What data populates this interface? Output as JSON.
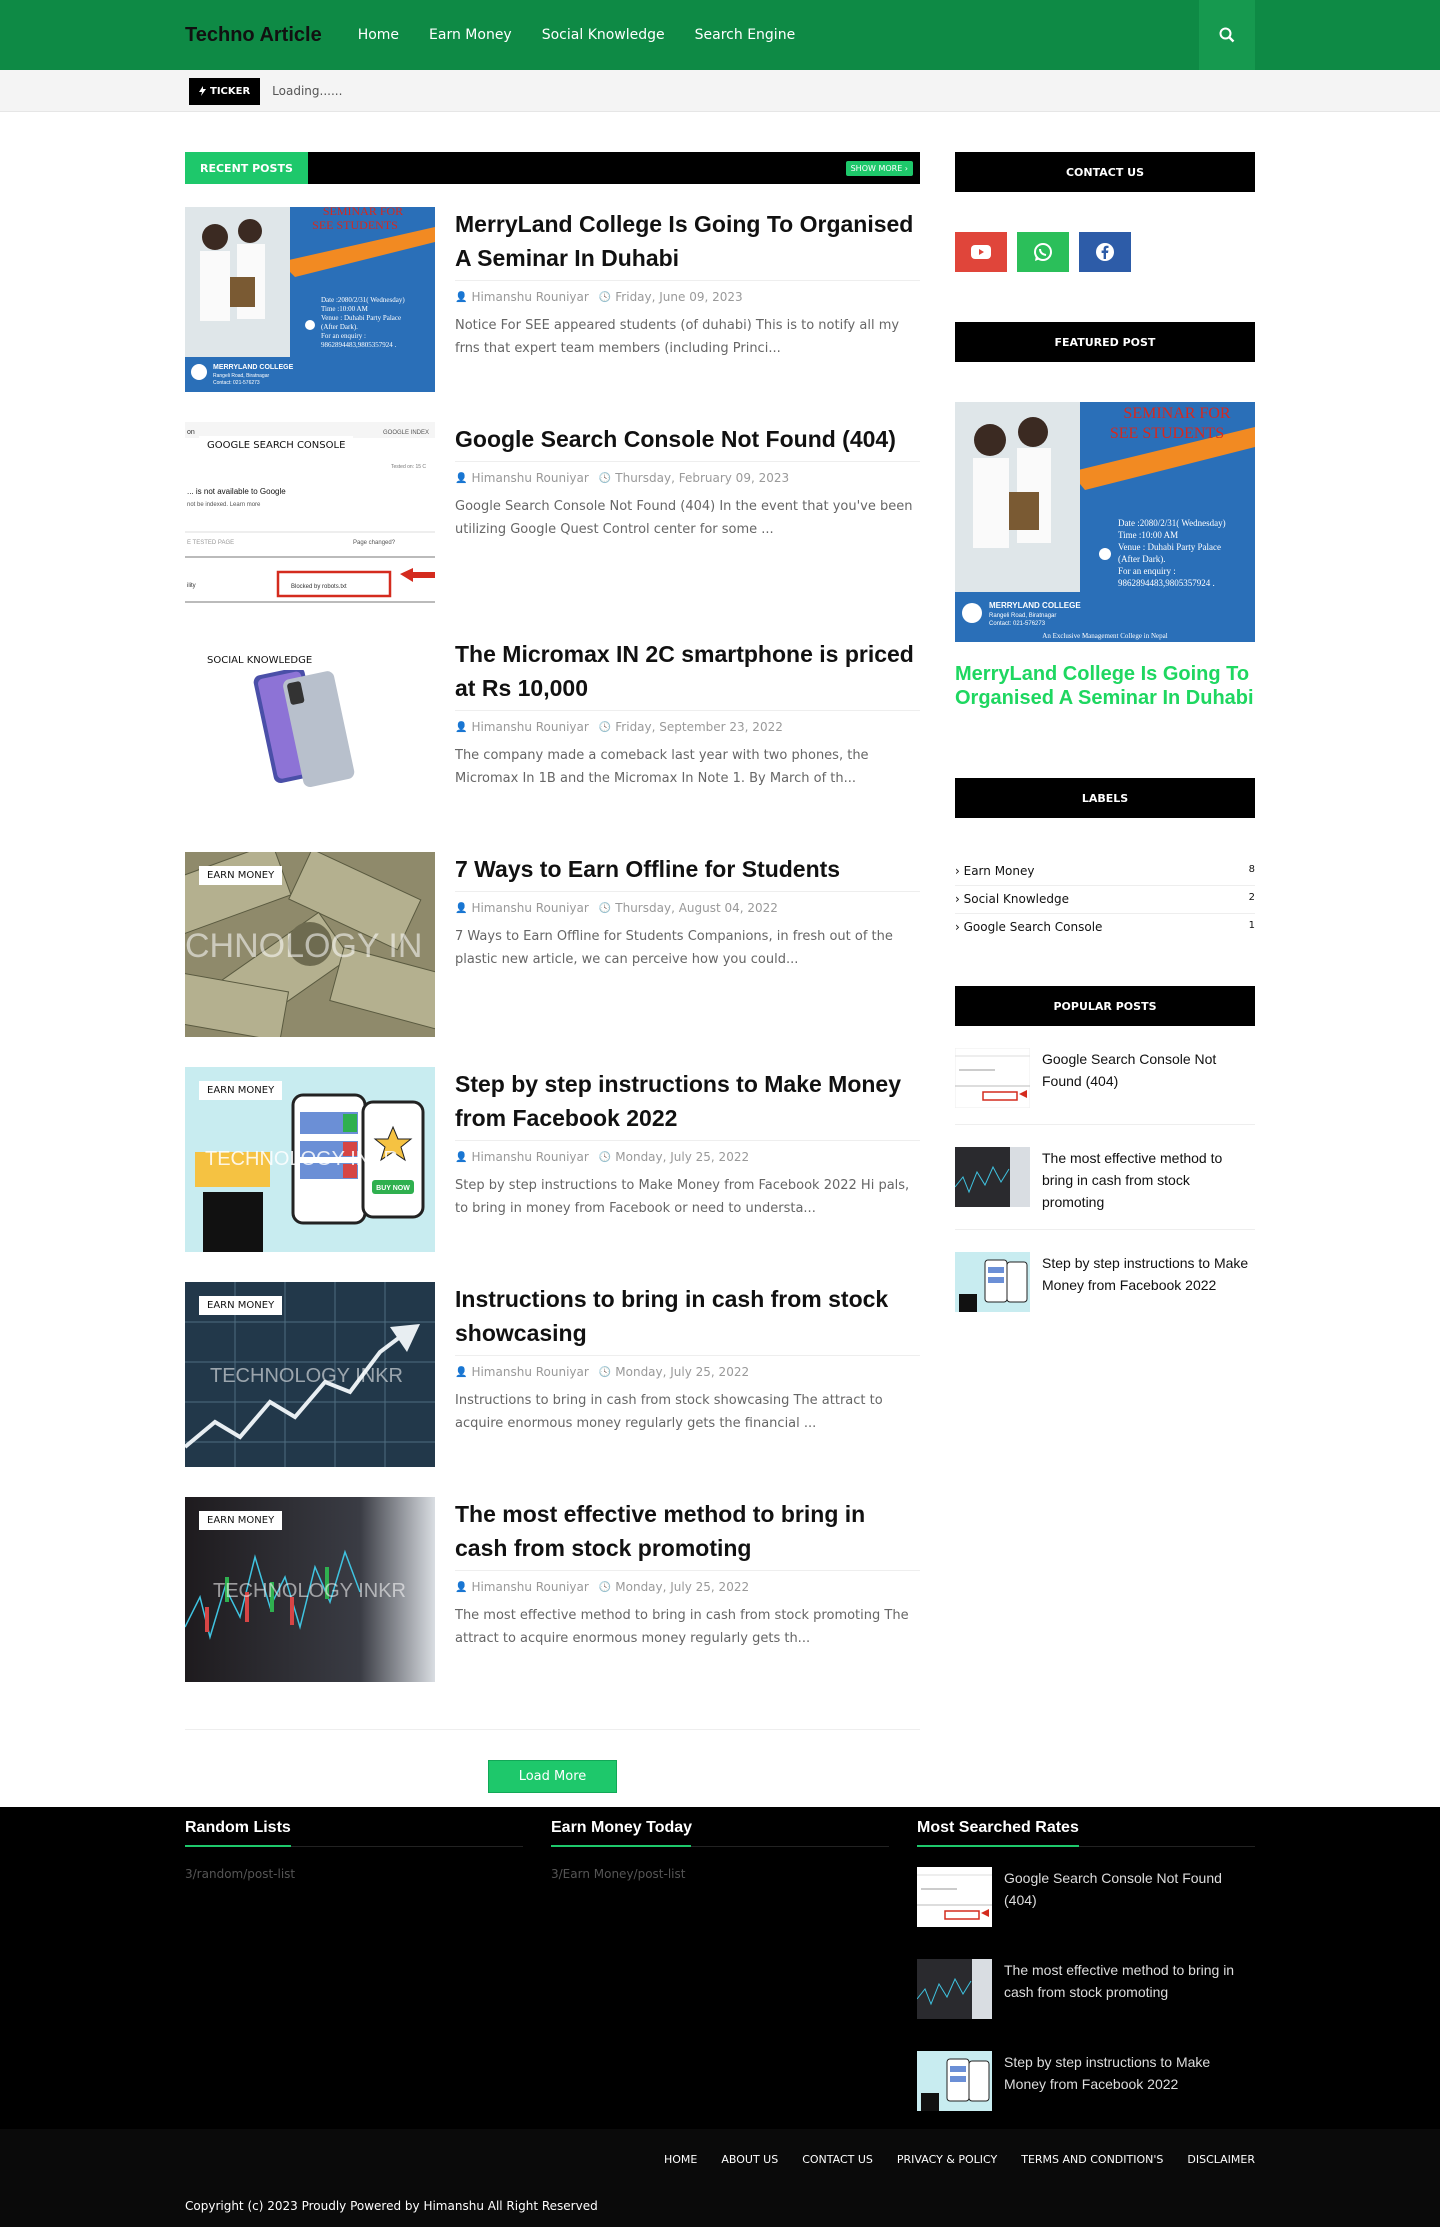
{
  "header": {
    "logo": "Techno Article",
    "nav": [
      "Home",
      "Earn Money",
      "Social Knowledge",
      "Search Engine"
    ]
  },
  "ticker": {
    "tag": "TICKER",
    "text": "Loading......"
  },
  "recent": {
    "title": "RECENT POSTS",
    "show_more": "SHOW MORE",
    "posts": [
      {
        "title": "MerryLand College Is Going To Organised A Seminar In Duhabi",
        "author": "Himanshu Rouniyar",
        "date": "Friday, June 09, 2023",
        "snippet": "Notice For SEE appeared students (of duhabi) This is to notify all my frns that expert team members (including Princi...",
        "label": ""
      },
      {
        "title": "Google Search Console Not Found (404)",
        "author": "Himanshu Rouniyar",
        "date": "Thursday, February 09, 2023",
        "snippet": "Google Search Console Not Found (404) In the event that you've been utilizing Google Quest Control center for some ...",
        "label": "GOOGLE SEARCH CONSOLE"
      },
      {
        "title": "The Micromax IN 2C smartphone is priced at Rs 10,000",
        "author": "Himanshu Rouniyar",
        "date": "Friday, September 23, 2022",
        "snippet": "The company made a comeback last year with two phones, the Micromax In 1B and the Micromax In Note 1.  By March of th...",
        "label": "SOCIAL KNOWLEDGE"
      },
      {
        "title": "7 Ways to Earn Offline for Students",
        "author": "Himanshu Rouniyar",
        "date": "Thursday, August 04, 2022",
        "snippet": "7 Ways to Earn Offline for Students Companions, in fresh out of the plastic new article, we can perceive how you could...",
        "label": "EARN MONEY"
      },
      {
        "title": "Step by step instructions to Make Money from Facebook 2022",
        "author": "Himanshu Rouniyar",
        "date": "Monday, July 25, 2022",
        "snippet": "Step by step instructions to Make Money from Facebook 2022 Hi pals, to bring in money from Facebook or need to understa...",
        "label": "EARN MONEY"
      },
      {
        "title": "Instructions to bring in cash from stock showcasing",
        "author": "Himanshu Rouniyar",
        "date": "Monday, July 25, 2022",
        "snippet": "Instructions to bring in cash from stock showcasing The attract to acquire enormous money regularly gets the financial ...",
        "label": "EARN MONEY"
      },
      {
        "title": "The most effective method to bring in cash from stock promoting",
        "author": "Himanshu Rouniyar",
        "date": "Monday, July 25, 2022",
        "snippet": "The most effective method to bring in cash from stock promoting The attract to acquire enormous money regularly gets th...",
        "label": "EARN MONEY"
      }
    ],
    "load_more": "Load More"
  },
  "thumb_text": {
    "seminar_heading1": "SEMINAR FOR",
    "seminar_heading2": "SEE STUDENTS",
    "seminar_date": "Date :2080/2/31( Wednesday)",
    "seminar_time": "Time :10:00 AM",
    "seminar_venue": "Venue : Duhabi Party Palace",
    "seminar_venue2": "(After Dark).",
    "seminar_enquiry": "For an enquiry :",
    "seminar_phone": "9862894483,9805357924 .",
    "seminar_college": "MERRYLAND COLLEGE",
    "seminar_road": "Rangeli Road, Biratnagar",
    "seminar_contact": "Contact: 021-576273",
    "seminar_tagline": "An Exclusive Management College in Nepal",
    "gsc_index": "GOOGLE INDEX",
    "gsc_tested": "Tested on: 15 C",
    "gsc_not": "... is not available to Google",
    "gsc_indexed": "not be indexed. Learn more",
    "gsc_tested_page": "E TESTED PAGE",
    "gsc_changed": "Page changed?",
    "gsc_ility": "ility",
    "gsc_blocked": "Blocked by robots.txt",
    "gsc_on": "on",
    "watermark": "TECHNOLOGY INKR",
    "watermark_short": "CHNOLOGY IN",
    "buy_now": "BUY NOW"
  },
  "sidebar": {
    "contact_title": "CONTACT US",
    "featured_title": "FEATURED POST",
    "featured_post": "MerryLand College Is Going To Organised A Seminar In Duhabi",
    "labels_title": "LABELS",
    "labels": [
      {
        "name": "Earn Money",
        "count": "8"
      },
      {
        "name": "Social Knowledge",
        "count": "2"
      },
      {
        "name": "Google Search Console",
        "count": "1"
      }
    ],
    "popular_title": "POPULAR POSTS",
    "popular": [
      "Google Search Console Not Found (404)",
      "The most effective method to bring in cash from stock promoting",
      "Step by step instructions to Make Money from Facebook 2022"
    ]
  },
  "footer": {
    "col1_title": "Random Lists",
    "col1_text": "3/random/post-list",
    "col2_title": "Earn Money Today",
    "col2_text": "3/Earn Money/post-list",
    "col3_title": "Most Searched Rates",
    "col3_items": [
      "Google Search Console Not Found (404)",
      "The most effective method to bring in cash from stock promoting",
      "Step by step instructions to Make Money from Facebook 2022"
    ],
    "nav": [
      "HOME",
      "ABOUT US",
      "CONTACT US",
      "PRIVACY & POLICY",
      "TERMS AND CONDITION'S",
      "DISCLAIMER"
    ],
    "copyright": "Copyright (c) 2023 Proudly Powered by Himanshu All Right Reserved"
  },
  "colors": {
    "header": "#0e8a45",
    "accent": "#1ec86b",
    "featured_title": "#1ed760",
    "youtube": "#e0453a",
    "whatsapp": "#2bbf5a",
    "facebook": "#2d5ca8"
  },
  "icons": [
    "search-icon",
    "bolt-icon",
    "chevron-right-icon",
    "user-icon",
    "clock-icon",
    "youtube-icon",
    "whatsapp-icon",
    "facebook-icon"
  ]
}
